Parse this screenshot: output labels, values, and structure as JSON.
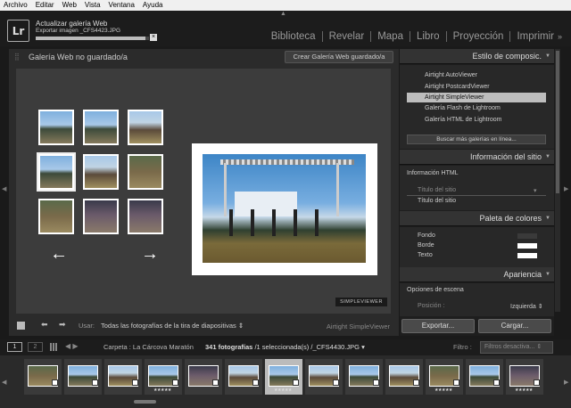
{
  "menubar": [
    "Archivo",
    "Editar",
    "Web",
    "Vista",
    "Ventana",
    "Ayuda"
  ],
  "activity": {
    "title": "Actualizar galería Web",
    "subtitle": "Exportar imagen _CFS4423.JPG",
    "progress": 0.97,
    "cancel_label": "×"
  },
  "app_logo": "Lr",
  "modules": [
    "Biblioteca",
    "Revelar",
    "Mapa",
    "Libro",
    "Proyección",
    "Imprimir"
  ],
  "modules_more": "»",
  "center": {
    "title": "Galería Web no guardado/a",
    "save_button": "Crear Galería Web guardado/a",
    "nav_left": "←",
    "nav_right": "→",
    "viewer_logo": "SIMPLEVIEWER"
  },
  "toolbar": {
    "use_label": "Usar:",
    "source": "Todas las fotografías de la tira de diapositivas",
    "source_arrow": "⇕",
    "layout_name": "Airtight SimpleViewer"
  },
  "right_panel": {
    "style_section": {
      "title": "Estilo de composic.",
      "items": [
        "Airtight AutoViewer",
        "Airtight PostcardViewer",
        "Airtight SimpleViewer",
        "Galería Flash de Lightroom",
        "Galería HTML de Lightroom"
      ],
      "selected": 2,
      "more_button": "Buscar más galerías en línea..."
    },
    "site_section": {
      "title": "Información del sitio",
      "subhead": "Información HTML",
      "field_placeholder": "Título del sitio",
      "field_value": "Título del sitio"
    },
    "palette_section": {
      "title": "Paleta de colores",
      "rows": [
        {
          "label": "Fondo",
          "color": "#3a3a3a"
        },
        {
          "label": "Borde",
          "color": "#ffffff"
        },
        {
          "label": "Texto",
          "color": "#ffffff"
        }
      ]
    },
    "appearance_section": {
      "title": "Apariencia",
      "subhead": "Opciones de escena",
      "position_label": "Posición :",
      "position_value": "Izquierda"
    },
    "export_button": "Exportar...",
    "upload_button": "Cargar..."
  },
  "filmstrip_header": {
    "view1": "1",
    "view2": "2",
    "folder": "Carpeta : La Cárcova Maratón",
    "count_bold": "341 fotografías",
    "count_rest": " /1 seleccionada(s) /_CFS4430.JPG",
    "filter_label": "Filtro :",
    "filter_value": "Filtros desactiva..."
  },
  "filmstrip": {
    "stars": "★★★★★",
    "thumbs": [
      {
        "style": "ph-c",
        "stars": false,
        "selected": false
      },
      {
        "style": "ph-a",
        "stars": false,
        "selected": false
      },
      {
        "style": "ph-b",
        "stars": false,
        "selected": false
      },
      {
        "style": "ph-a",
        "stars": true,
        "selected": false
      },
      {
        "style": "ph-d",
        "stars": false,
        "selected": false
      },
      {
        "style": "ph-b",
        "stars": false,
        "selected": false
      },
      {
        "style": "ph-a",
        "stars": true,
        "selected": true
      },
      {
        "style": "ph-b",
        "stars": false,
        "selected": false
      },
      {
        "style": "ph-a",
        "stars": false,
        "selected": false
      },
      {
        "style": "ph-b",
        "stars": false,
        "selected": false
      },
      {
        "style": "ph-c",
        "stars": true,
        "selected": false
      },
      {
        "style": "ph-a",
        "stars": false,
        "selected": false
      },
      {
        "style": "ph-d",
        "stars": true,
        "selected": false
      }
    ]
  }
}
